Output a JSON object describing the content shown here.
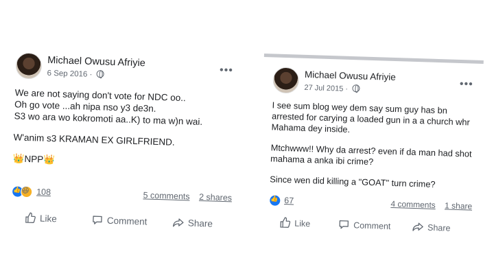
{
  "posts": [
    {
      "author": "Michael Owusu Afriyie",
      "date": "6 Sep 2016 ·",
      "more": "•••",
      "paragraphs": [
        "We are not saying don't vote for NDC oo..\nOh go vote ...ah nipa nso y3 de3n.\nS3 wo ara wo kokromoti aa..K) to ma w)n wai.",
        "W'anim s3 KRAMAN EX GIRLFRIEND.",
        "👑NPP👑"
      ],
      "reaction_count": "108",
      "comments": "5 comments",
      "shares": "2 shares",
      "actions": {
        "like": "Like",
        "comment": "Comment",
        "share": "Share"
      }
    },
    {
      "author": "Michael Owusu Afriyie",
      "date": "27 Jul 2015 ·",
      "more": "•••",
      "paragraphs": [
        "I see sum blog wey dem say sum guy has bn arrested for carying a loaded gun in a a church whr Mahama dey inside.",
        "Mtchwww!! Why da arrest? even if da man had shot mahama a anka ibi crime?",
        "Since wen did killing a \"GOAT\" turn crime?"
      ],
      "reaction_count": "67",
      "comments": "4 comments",
      "shares": "1 share",
      "actions": {
        "like": "Like",
        "comment": "Comment",
        "share": "Share"
      }
    }
  ]
}
